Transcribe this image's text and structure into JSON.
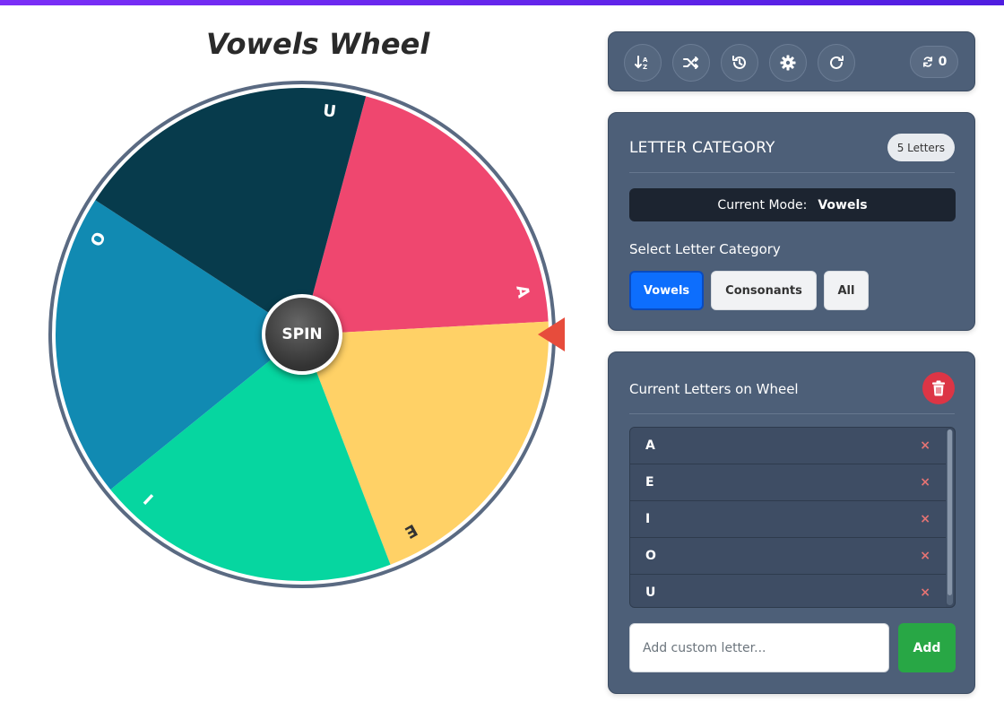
{
  "page": {
    "accent_gradient": [
      "#7b2ff7",
      "#4f1de0"
    ]
  },
  "wheel": {
    "title": "Vowels Wheel",
    "spin_label": "SPIN",
    "pointer_color": "#e74c3c",
    "segments": [
      {
        "letter": "A",
        "color": "#ef476f"
      },
      {
        "letter": "E",
        "color": "#ffd166"
      },
      {
        "letter": "I",
        "color": "#06d6a0"
      },
      {
        "letter": "O",
        "color": "#118ab2"
      },
      {
        "letter": "U",
        "color": "#073b4c"
      }
    ]
  },
  "toolbar": {
    "buttons": [
      {
        "name": "sort-icon"
      },
      {
        "name": "shuffle-icon"
      },
      {
        "name": "history-icon"
      },
      {
        "name": "gear-icon"
      },
      {
        "name": "reset-icon"
      }
    ],
    "spin_count": "0"
  },
  "category": {
    "title": "LETTER CATEGORY",
    "count_badge": "5 Letters",
    "mode_label": "Current Mode:",
    "mode_value": "Vowels",
    "select_label": "Select Letter Category",
    "buttons": [
      "Vowels",
      "Consonants",
      "All"
    ],
    "active": "Vowels"
  },
  "letters": {
    "title": "Current Letters on Wheel",
    "items": [
      "A",
      "E",
      "I",
      "O",
      "U"
    ],
    "remove_symbol": "×",
    "input_placeholder": "Add custom letter...",
    "add_label": "Add"
  }
}
